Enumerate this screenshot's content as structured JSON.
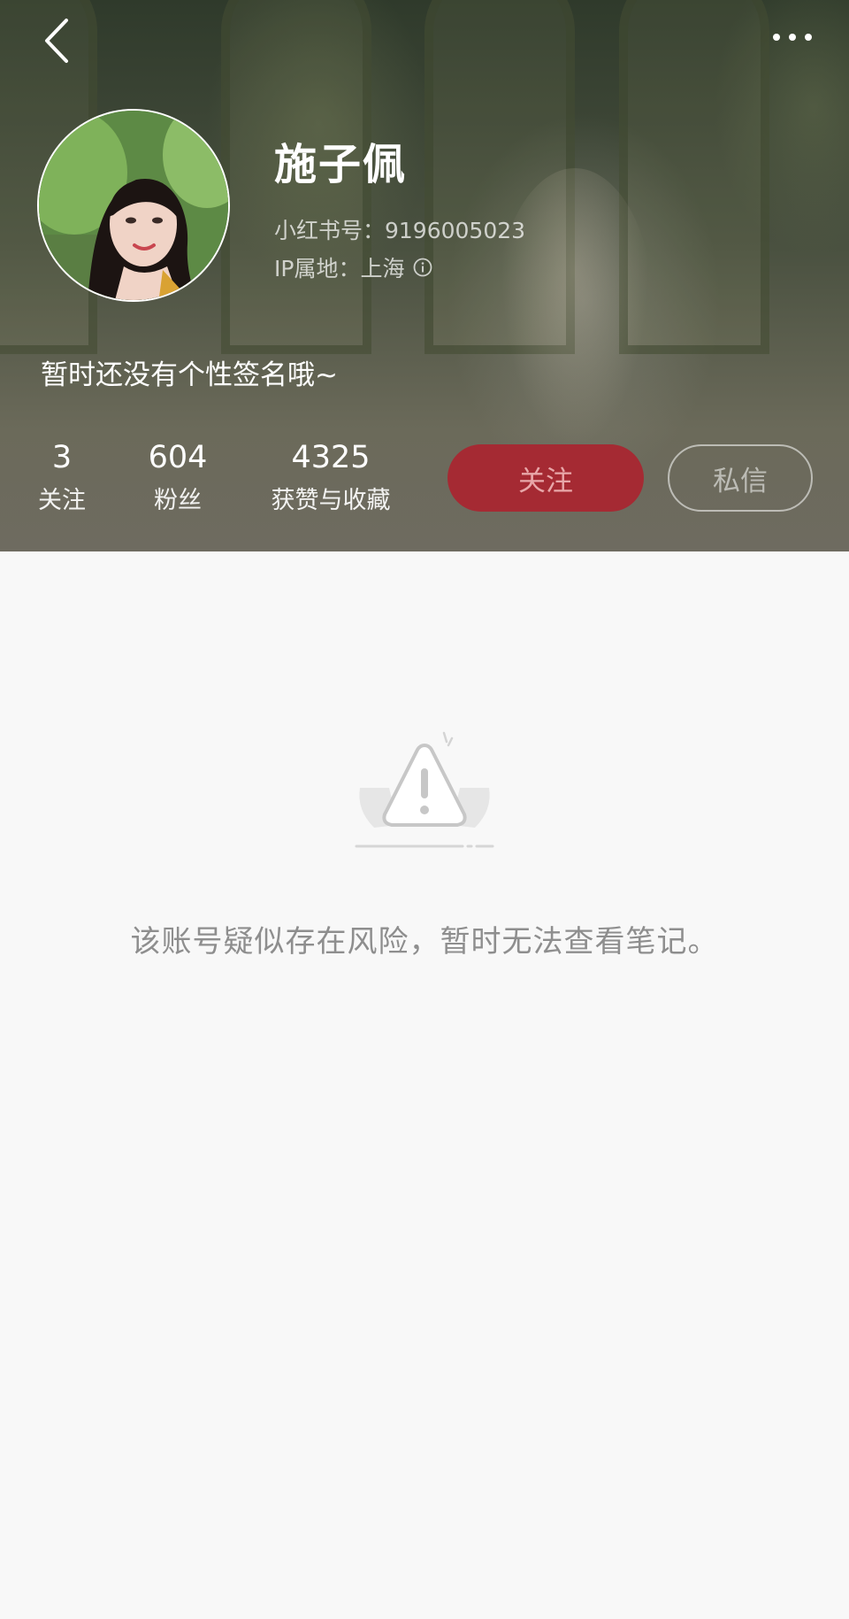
{
  "profile": {
    "name": "施子佩",
    "id_line": "小红书号：9196005023",
    "ip_line": "IP属地：上海",
    "bio": "暂时还没有个性签名哦~"
  },
  "stats": [
    {
      "value": "3",
      "label": "关注"
    },
    {
      "value": "604",
      "label": "粉丝"
    },
    {
      "value": "4325",
      "label": "获赞与收藏"
    }
  ],
  "actions": {
    "follow_label": "关注",
    "message_label": "私信"
  },
  "empty_state": {
    "message": "该账号疑似存在风险，暂时无法查看笔记。"
  },
  "icons": {
    "back": "chevron-left-icon",
    "more": "more-horizontal-icon",
    "info": "info-icon",
    "warning": "warning-triangle-icon"
  },
  "colors": {
    "follow_button": "#a52a33",
    "page_background": "#f8f8f8",
    "empty_text": "#8e8e8e"
  }
}
